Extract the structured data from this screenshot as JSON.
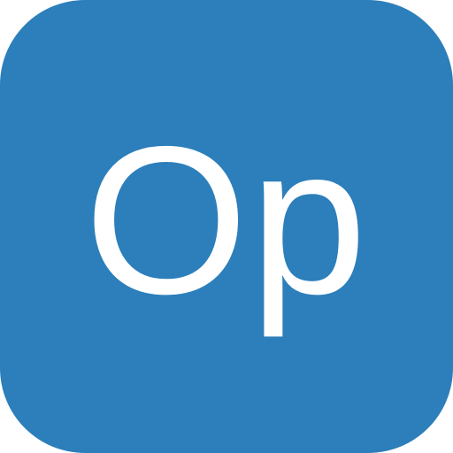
{
  "app_icon": {
    "label": "Op",
    "background_color": "#2c7fba",
    "text_color": "#ffffff"
  }
}
